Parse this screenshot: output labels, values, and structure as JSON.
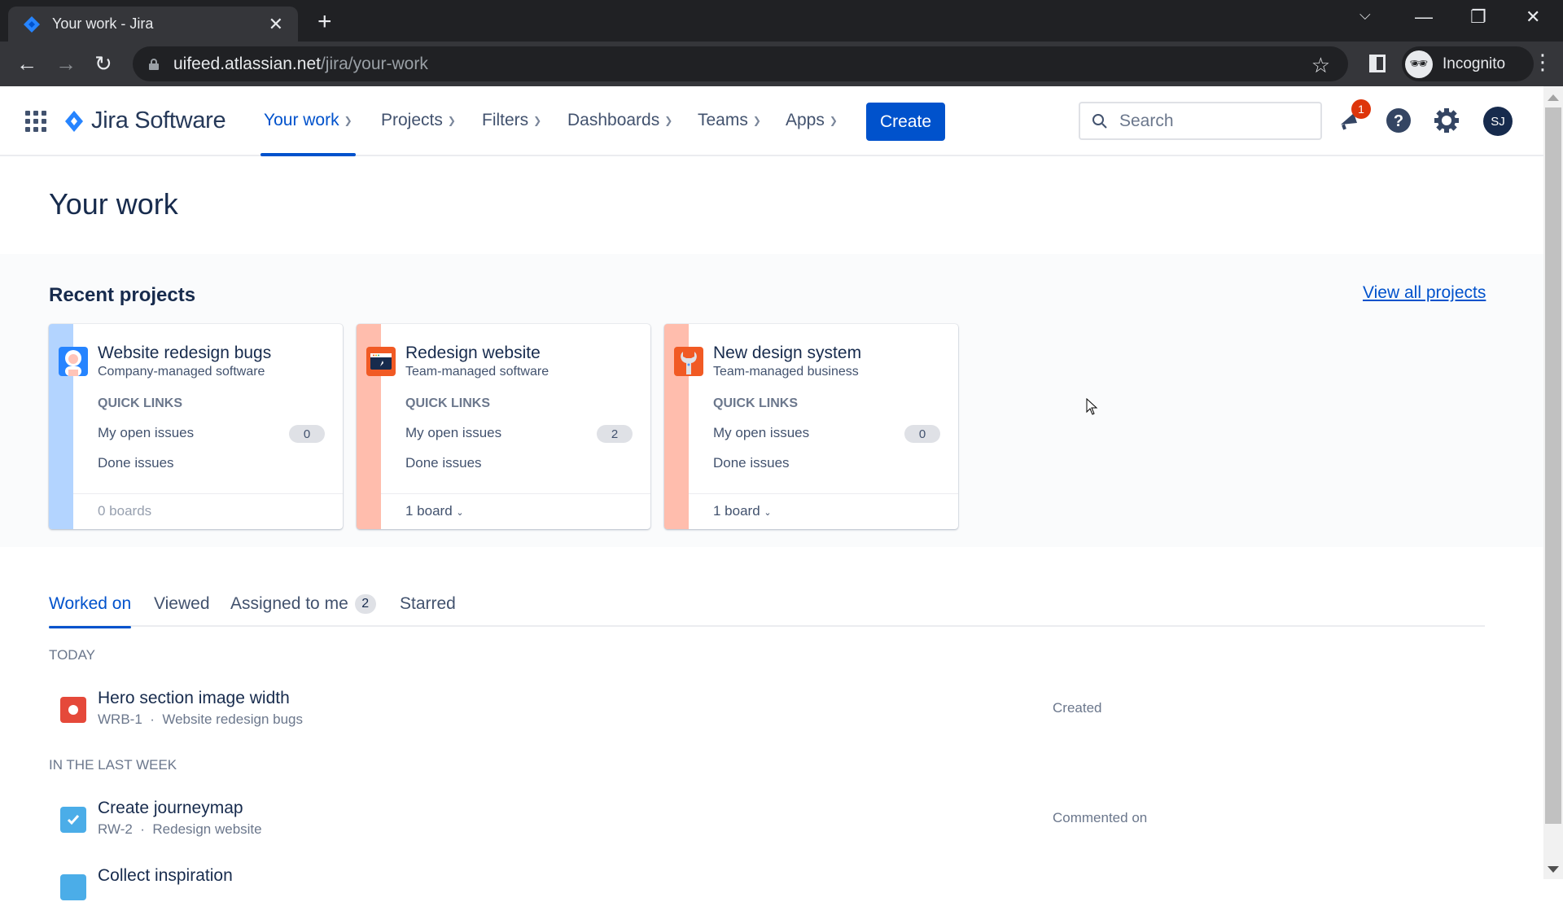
{
  "browser": {
    "tab_title": "Your work - Jira",
    "url_host": "uifeed.atlassian.net",
    "url_path": "/jira/your-work",
    "profile_label": "Incognito"
  },
  "nav": {
    "product_name": "Jira Software",
    "items": [
      {
        "label": "Your work",
        "active": true
      },
      {
        "label": "Projects"
      },
      {
        "label": "Filters"
      },
      {
        "label": "Dashboards"
      },
      {
        "label": "Teams"
      },
      {
        "label": "Apps"
      }
    ],
    "create_label": "Create",
    "search_placeholder": "Search",
    "notification_count": "1",
    "avatar_initials": "SJ"
  },
  "page": {
    "title": "Your work",
    "recent_projects_title": "Recent projects",
    "view_all_label": "View all projects"
  },
  "projects": [
    {
      "name": "Website redesign bugs",
      "type": "Company-managed software",
      "quick_links_label": "QUICK LINKS",
      "open_issues_label": "My open issues",
      "open_issues_count": "0",
      "done_issues_label": "Done issues",
      "boards_label": "0 boards",
      "accent": "#b3d4ff",
      "icon": "yeti-avatar-icon"
    },
    {
      "name": "Redesign website",
      "type": "Team-managed software",
      "quick_links_label": "QUICK LINKS",
      "open_issues_label": "My open issues",
      "open_issues_count": "2",
      "done_issues_label": "Done issues",
      "boards_label": "1 board",
      "accent": "#ffbdad",
      "icon": "browser-rocket-icon"
    },
    {
      "name": "New design system",
      "type": "Team-managed business",
      "quick_links_label": "QUICK LINKS",
      "open_issues_label": "My open issues",
      "open_issues_count": "0",
      "done_issues_label": "Done issues",
      "boards_label": "1 board",
      "accent": "#ffbdad",
      "icon": "wrench-icon"
    }
  ],
  "work_tabs": [
    {
      "label": "Worked on",
      "active": true
    },
    {
      "label": "Viewed"
    },
    {
      "label": "Assigned to me",
      "count": "2"
    },
    {
      "label": "Starred"
    }
  ],
  "groups": [
    {
      "label": "TODAY",
      "issues": [
        {
          "title": "Hero section image width",
          "key": "WRB-1",
          "project": "Website redesign bugs",
          "action": "Created",
          "type": "bug"
        }
      ]
    },
    {
      "label": "IN THE LAST WEEK",
      "issues": [
        {
          "title": "Create journeymap",
          "key": "RW-2",
          "project": "Redesign website",
          "action": "Commented on",
          "type": "task"
        },
        {
          "title": "Collect inspiration",
          "type": "task"
        }
      ]
    }
  ],
  "meta_separator": "·"
}
